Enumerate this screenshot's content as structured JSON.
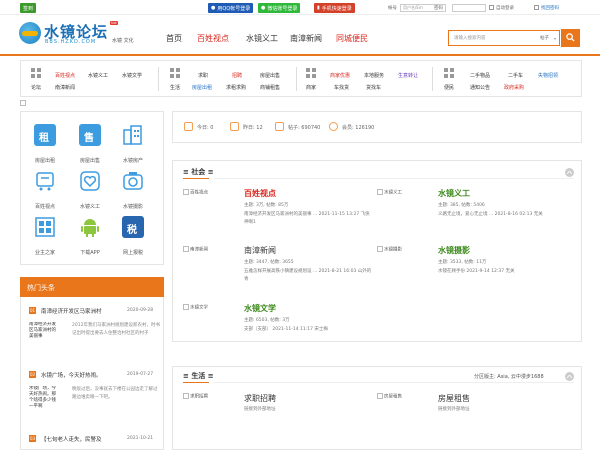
{
  "topbar": {
    "signin_label": "签到",
    "qq_label": "用QQ帐号登录",
    "wechat_label": "微信账号登录",
    "phone_label": "手机快速登录",
    "account_label": "帐号",
    "account_placeholder": "用户名/Em",
    "password_label": "密码",
    "auto_login_label": "自动登录",
    "forgot_label": "找回密码"
  },
  "header": {
    "site_title": "水镜论坛",
    "site_sub": "BBS.HZKD.COM",
    "tagline": "水镜 文化",
    "hot_badge": "hot",
    "nav": [
      {
        "label": "首页"
      },
      {
        "label": "百姓视点"
      },
      {
        "label": "水镜义工"
      },
      {
        "label": "南漳新闻"
      },
      {
        "label": "同城便民"
      }
    ],
    "search": {
      "placeholder": "请输入搜索内容",
      "category": "帖子"
    }
  },
  "catbar": {
    "groups": [
      {
        "name": "论坛",
        "links": [
          "百姓视点",
          "水镜义工",
          "水镜文学",
          "南漳新闻"
        ]
      },
      {
        "name": "生活",
        "links": [
          "求职",
          "招聘",
          "房屋出售",
          "房屋出租",
          "求租求购",
          "商铺租售"
        ]
      },
      {
        "name": "商家",
        "links": [
          "商家优惠",
          "本地服务",
          "生意转让",
          "车找货",
          "货找车"
        ]
      },
      {
        "name": "便民",
        "links": [
          "二手物品",
          "二手车",
          "失物招领",
          "通知公告",
          "政府采购"
        ]
      }
    ]
  },
  "tiles": [
    {
      "label": "房屋出租"
    },
    {
      "label": "房屋出售"
    },
    {
      "label": "水镜房产"
    },
    {
      "label": "百姓视点"
    },
    {
      "label": "水镜义工"
    },
    {
      "label": "水镜摄影"
    },
    {
      "label": "业主之家"
    },
    {
      "label": "下载APP"
    },
    {
      "label": "网上报税"
    }
  ],
  "tile_glyphs": {
    "rent": "租",
    "sale": "售",
    "tax": "税"
  },
  "hot": {
    "title": "热门头条",
    "items": [
      {
        "num": "01",
        "title": "南漳经济开发区马家洲村",
        "date": "2020-09-28",
        "img": "南漳经济开发区马家洲村的美丽事",
        "desc": "2012年我们马家洲村规划建设新农村，时书记出时提出要去人住整治村社区的村子"
      },
      {
        "num": "02",
        "title": "水镜广场，今天好热闹。",
        "date": "2019-07-27",
        "img": "水镜广场，今天好热闹。那个啥得多少钱一平啊",
        "desc": "晚饭过后，没事就去下楼在公园边走了解过 路边谁卖眼一下吧。"
      },
      {
        "num": "03",
        "title": "【七旬老人走失，民警及",
        "date": "2021-10-21"
      }
    ]
  },
  "stats": {
    "today": "今日: 0",
    "yesterday": "昨日: 12",
    "posts": "帖子: 690740",
    "members": "会员: 126190"
  },
  "sections": {
    "social": {
      "title": "社会",
      "forums": [
        {
          "img": "百姓视点",
          "title": "百姓视点",
          "meta": "主题: 3万, 帖数: 85万",
          "desc": "南漳经济开发区马家洲村的美丽事 ... 2021-11-15 13:27 飞侠神啊1"
        },
        {
          "img": "水镜义工",
          "title": "水镜义工",
          "meta": "主题: 385, 帖数: 5406",
          "desc": "义路无止境，爱心无止境 ... 2021-8-16 02:13 无关"
        },
        {
          "img": "南漳新闻",
          "title": "南漳新闻",
          "meta": "主题: 3447, 帖数: 3655",
          "desc": "五雅怎样开展高铁小镇建设规划设 ... 2021-8-21 16:03 山外的青"
        },
        {
          "img": "水镜摄影",
          "title": "水镜摄影",
          "meta": "主题: 3533, 帖数: 11万",
          "desc": "水镜在顾手份 2021-9-14 12:37 无关"
        },
        {
          "img": "水镜文学",
          "title": "水镜文学",
          "meta": "主题: 6503, 帖数: 3万",
          "desc": "支部（支部）   2021-11-14 11:17 宋士梅"
        }
      ]
    },
    "life": {
      "title": "生活",
      "moderator": "分区版主: Asia, 云中漫步1688",
      "forums": [
        {
          "img": "求职招聘",
          "title": "求职招聘",
          "desc": "链接到外部地址"
        },
        {
          "img": "房屋租售",
          "title": "房屋租售",
          "desc": "链接到外部地址"
        }
      ]
    }
  }
}
